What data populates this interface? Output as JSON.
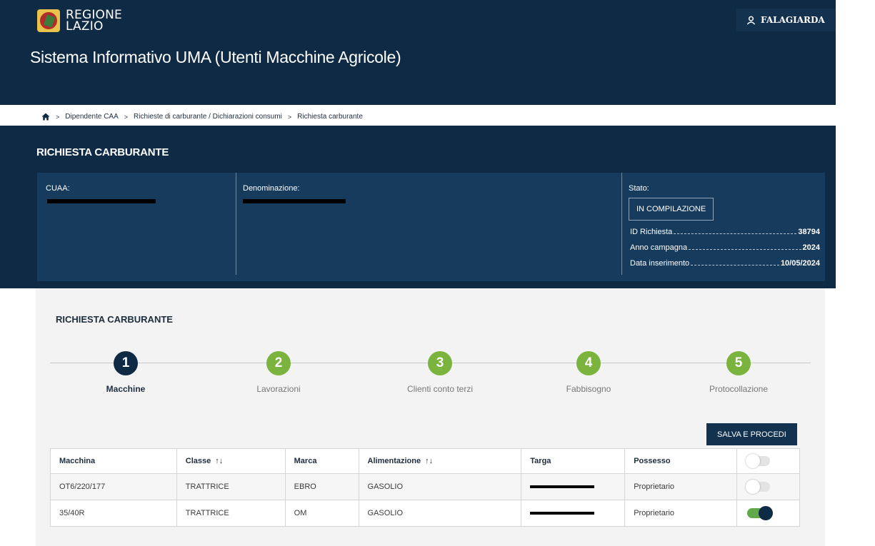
{
  "header": {
    "logo_line1": "REGIONE",
    "logo_line2": "LAZIO",
    "user_name": "FALAGIARDA",
    "app_title": "Sistema Informativo UMA (Utenti Macchine Agricole)"
  },
  "breadcrumb": [
    "Dipendente CAA",
    "Richieste di carburante / Dichiarazioni consumi",
    "Richiesta carburante"
  ],
  "hero": {
    "title": "RICHIESTA CARBURANTE",
    "cuaa_label": "CUAA:",
    "denominazione_label": "Denominazione:",
    "stato_label": "Stato:",
    "status": "IN COMPILAZIONE",
    "details": [
      {
        "label": "ID Richiesta",
        "value": "38794"
      },
      {
        "label": "Anno campagna",
        "value": "2024"
      },
      {
        "label": "Data inserimento",
        "value": "10/05/2024"
      }
    ]
  },
  "panel": {
    "title": "RICHIESTA CARBURANTE",
    "save_label": "SALVA E PROCEDI"
  },
  "steps": [
    {
      "number": "1",
      "label": "Macchine"
    },
    {
      "number": "2",
      "label": "Lavorazioni"
    },
    {
      "number": "3",
      "label": "Clienti conto terzi"
    },
    {
      "number": "4",
      "label": "Fabbisogno"
    },
    {
      "number": "5",
      "label": "Protocollazione"
    }
  ],
  "table": {
    "headers": [
      "Macchina",
      "Classe",
      "Marca",
      "Alimentazione",
      "Targa",
      "Possesso"
    ],
    "rows": [
      {
        "macchina": "OT6/220/177",
        "classe": "TRATTRICE",
        "marca": "EBRO",
        "alimentazione": "GASOLIO",
        "possesso": "Proprietario",
        "selected": false
      },
      {
        "macchina": "35/40R",
        "classe": "TRATTRICE",
        "marca": "OM",
        "alimentazione": "GASOLIO",
        "possesso": "Proprietario",
        "selected": true
      }
    ]
  },
  "colors": {
    "navy": "#0e2a45",
    "panel_blue": "#163b5c",
    "step_active": "#0e2a45",
    "step_green": "#7ab33e",
    "toggle_on": "#61a84a"
  },
  "icons": {
    "home": "home-icon",
    "user": "user-icon",
    "sort": "sort-arrows-icon"
  }
}
